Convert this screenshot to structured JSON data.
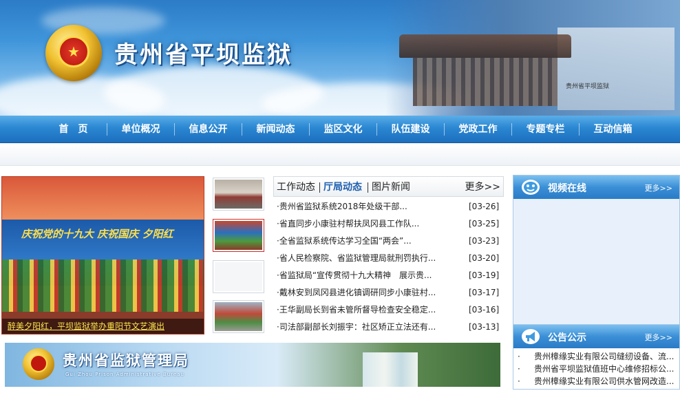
{
  "header": {
    "site_title": "贵州省平坝监狱",
    "photo_sign": "贵州省平坝监狱"
  },
  "nav": {
    "items": [
      {
        "label": "首　页"
      },
      {
        "label": "单位概况"
      },
      {
        "label": "信息公开"
      },
      {
        "label": "新闻动态"
      },
      {
        "label": "监区文化"
      },
      {
        "label": "队伍建设"
      },
      {
        "label": "党政工作"
      },
      {
        "label": "专题专栏"
      },
      {
        "label": "互动信箱"
      }
    ]
  },
  "slideshow": {
    "caption": "醉美夕阳红，平坝监狱举办重阳节文艺演出",
    "banner_text": "庆祝党的十九大  庆祝国庆 夕阳红"
  },
  "news": {
    "tabs": [
      "工作动态",
      "厅局动态",
      "图片新闻"
    ],
    "active_tab": 1,
    "more_label": "更多>>",
    "items": [
      {
        "title": "·贵州省监狱系统2018年处级干部...",
        "date": "[03-26]"
      },
      {
        "title": "·省直同步小康驻村帮扶凤冈县工作队...",
        "date": "[03-25]"
      },
      {
        "title": "·全省监狱系统传达学习全国“两会”...",
        "date": "[03-23]"
      },
      {
        "title": "·省人民检察院、省监狱管理局就刑罚执行...",
        "date": "[03-20]"
      },
      {
        "title": "·省监狱局“宣传贯彻十九大精神　展示贵...",
        "date": "[03-19]"
      },
      {
        "title": "·戴林安到凤冈县进化镇调研同步小康驻村...",
        "date": "[03-17]"
      },
      {
        "title": "·王华副局长到省未管所督导检查安全稳定...",
        "date": "[03-16]"
      },
      {
        "title": "·司法部副部长刘振宇：社区矫正立法还有...",
        "date": "[03-13]"
      }
    ]
  },
  "video": {
    "title": "视频在线",
    "more_label": "更多>>"
  },
  "notice": {
    "title": "公告公示",
    "more_label": "更多>>",
    "items": [
      {
        "text": "贵州樟缘实业有限公司缝纫设备、流..."
      },
      {
        "text": "贵州省平坝监狱值班中心维修招标公..."
      },
      {
        "text": "贵州樟缘实业有限公司供水管网改造..."
      }
    ]
  },
  "ad": {
    "title": "贵州省监狱管理局",
    "subtitle": "Gui Zhou Prison Administrative Bureau"
  }
}
